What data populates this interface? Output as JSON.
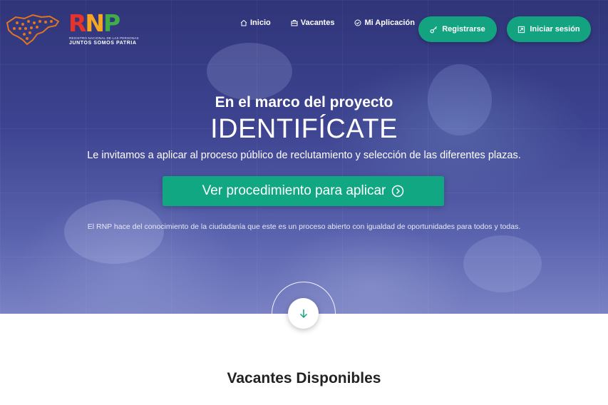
{
  "logo": {
    "wordmark": [
      "R",
      "N",
      "P"
    ],
    "wordmark_colors": [
      "#e8332a",
      "#f5a623",
      "#3fae49"
    ],
    "subtitle": "REGISTRO NACIONAL DE LAS PERSONAS",
    "tagline": "JUNTOS SOMOS PATRIA",
    "map_color": "#e0741f"
  },
  "nav": {
    "items": [
      {
        "label": "Inicio",
        "icon": "home-icon"
      },
      {
        "label": "Vacantes",
        "icon": "briefcase-icon"
      },
      {
        "label": "Mi Aplicación",
        "icon": "check-circle-icon"
      }
    ]
  },
  "auth": {
    "register_label": "Registrarse",
    "login_label": "Iniciar sesión"
  },
  "hero": {
    "title": "En el marco del proyecto",
    "project": "IDENTIFÍCATE",
    "subtitle": "Le invitamos a aplicar al proceso público de reclutamiento y selección de las diferentes plazas.",
    "cta_label": "Ver procedimiento para aplicar",
    "notice": "El RNP hace del conocimiento de la ciudadanía que este es un proceso abierto con igualdad de oportunidades para todos y todas."
  },
  "section": {
    "title": "Vacantes Disponibles"
  },
  "colors": {
    "accent": "#13a380",
    "hero_bg": "#3d4390",
    "arrow": "#13a380"
  }
}
